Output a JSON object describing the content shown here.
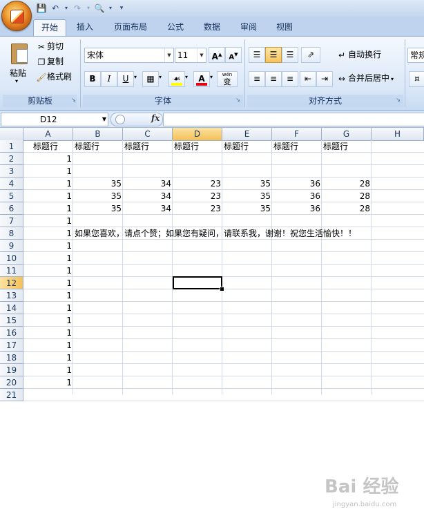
{
  "quick_access": {
    "save_icon": "save-icon",
    "undo_icon": "undo-icon",
    "redo_icon": "redo-icon",
    "print_preview_icon": "print-preview-icon",
    "customize_icon": "customize-qat-icon"
  },
  "tabs": [
    {
      "label": "开始",
      "active": true
    },
    {
      "label": "插入"
    },
    {
      "label": "页面布局"
    },
    {
      "label": "公式"
    },
    {
      "label": "数据"
    },
    {
      "label": "审阅"
    },
    {
      "label": "视图"
    }
  ],
  "ribbon": {
    "clipboard": {
      "paste": "粘贴",
      "cut": "剪切",
      "copy": "复制",
      "format_painter": "格式刷",
      "group": "剪贴板"
    },
    "font": {
      "name": "宋体",
      "size": "11",
      "bold": "B",
      "italic": "I",
      "underline": "U",
      "grow": "A",
      "shrink": "A",
      "font_color": "A",
      "phonetic": "wén",
      "phonetic_char": "变",
      "group": "字体",
      "font_color_hex": "#e3000f",
      "fill_color_hex": "#ffff00"
    },
    "alignment": {
      "wrap_text": "自动换行",
      "merge_center": "合并后居中",
      "group": "对齐方式"
    },
    "number": {
      "format": "常规"
    }
  },
  "formula_bar": {
    "name_box": "D12",
    "fx": "fx",
    "formula": ""
  },
  "grid": {
    "columns": [
      "A",
      "B",
      "C",
      "D",
      "E",
      "F",
      "G",
      "H"
    ],
    "rows": [
      "1",
      "2",
      "3",
      "4",
      "5",
      "6",
      "7",
      "8",
      "9",
      "10",
      "11",
      "12",
      "13",
      "14",
      "15",
      "16",
      "17",
      "18",
      "19",
      "20",
      "21"
    ],
    "selected_column": "D",
    "selected_row": "12",
    "header_row": [
      "标题行",
      "标题行",
      "标题行",
      "标题行",
      "标题行",
      "标题行",
      "标题行"
    ],
    "column_a_value": "1",
    "data_rows": [
      [
        "35",
        "34",
        "23",
        "35",
        "36",
        "28"
      ],
      [
        "35",
        "34",
        "23",
        "35",
        "36",
        "28"
      ],
      [
        "35",
        "34",
        "23",
        "35",
        "36",
        "28"
      ]
    ],
    "message": "如果您喜欢，请点个赞；如果您有疑问，请联系我，谢谢！祝您生活愉快！！"
  },
  "watermark": {
    "text": "Bai 经验",
    "sub": "jingyan.baidu.com"
  }
}
